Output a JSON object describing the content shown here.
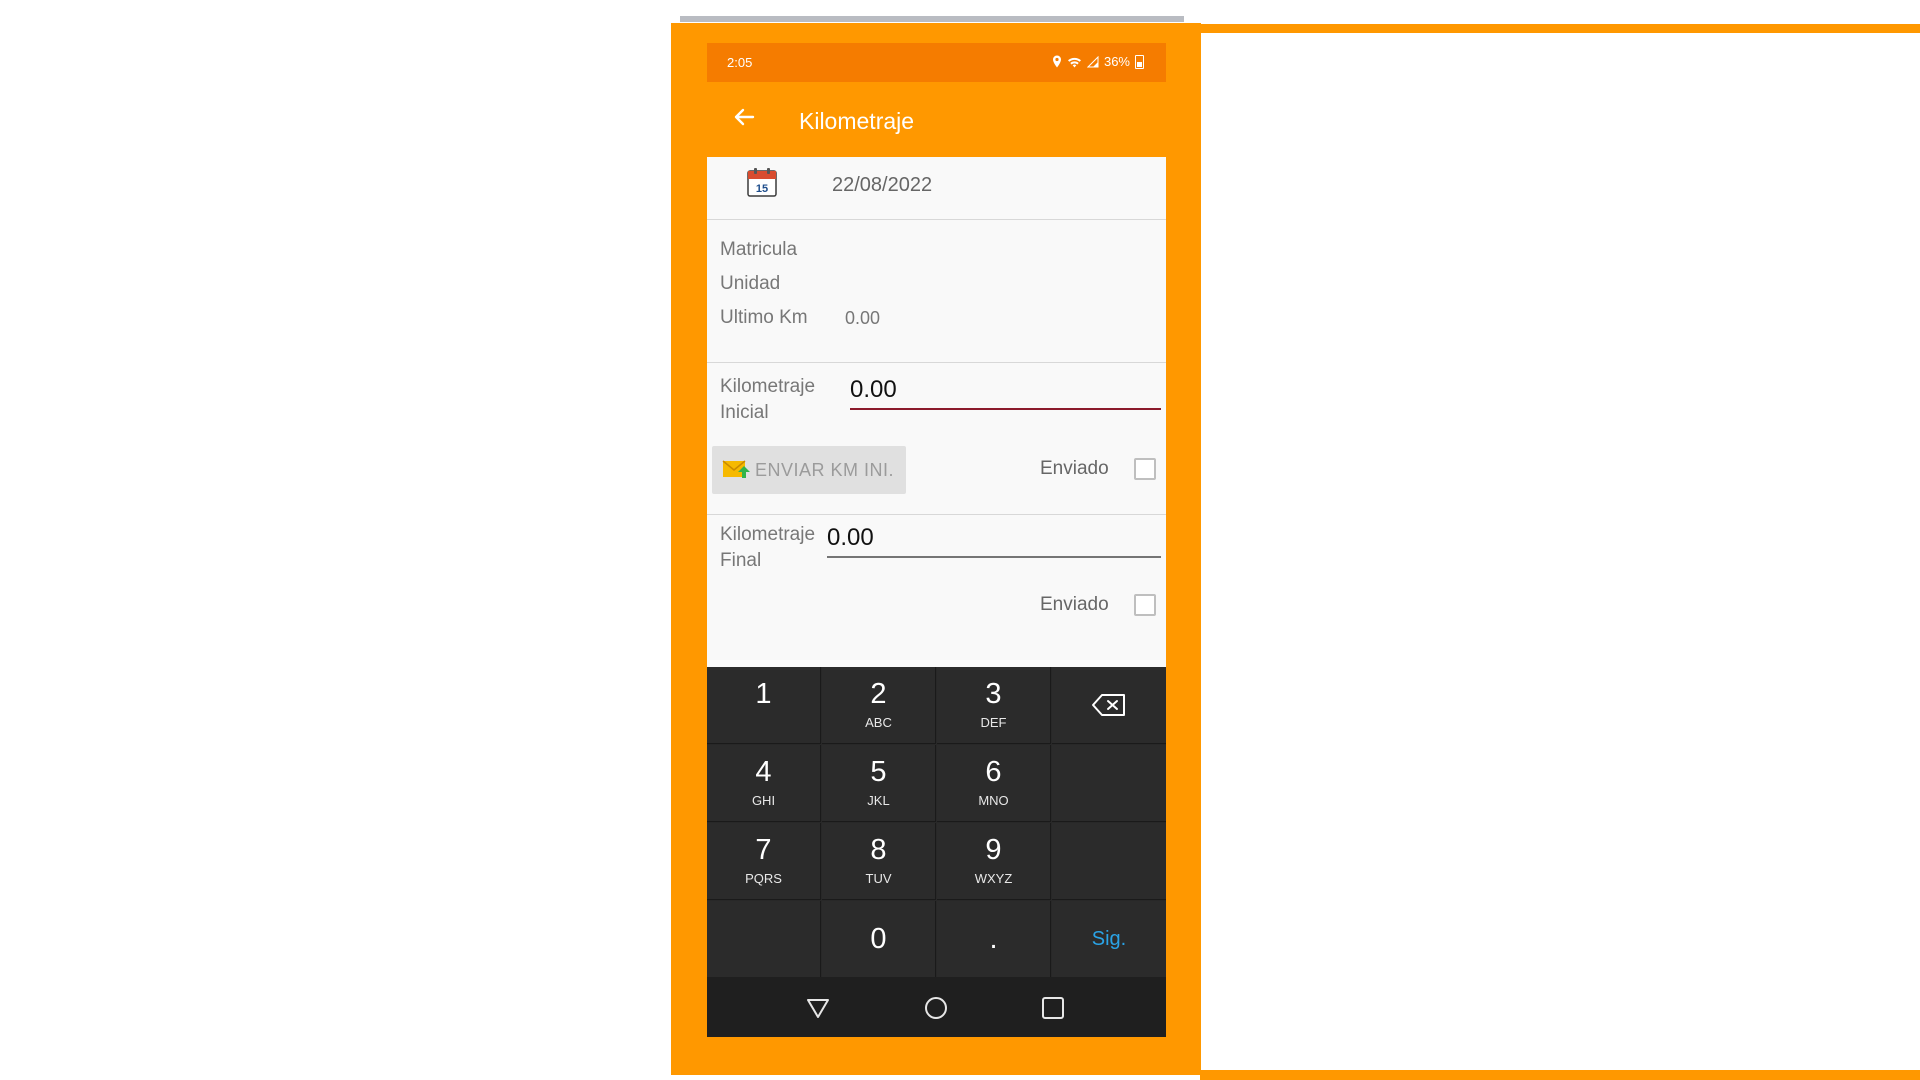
{
  "status_bar": {
    "time": "2:05",
    "battery": "36%"
  },
  "app_bar": {
    "title": "Kilometraje",
    "back_icon": "arrow-left-icon"
  },
  "date_row": {
    "date": "22/08/2022",
    "icon": "calendar-icon",
    "calendar_day": "15"
  },
  "info": {
    "matricula_label": "Matricula",
    "unidad_label": "Unidad",
    "ultimo_km_label": "Ultimo Km",
    "ultimo_km_value": "0.00"
  },
  "km_inicial": {
    "label_line1": "Kilometraje",
    "label_line2": "Inicial",
    "value": "0.00",
    "send_button_label": "ENVIAR KM INI.",
    "enviado_label": "Enviado",
    "enviado_checked": false
  },
  "km_final": {
    "label_line1": "Kilometraje",
    "label_line2": "Final",
    "value": "0.00",
    "enviado_label": "Enviado",
    "enviado_checked": false
  },
  "keypad": {
    "keys": [
      {
        "digit": "1",
        "letters": ""
      },
      {
        "digit": "2",
        "letters": "ABC"
      },
      {
        "digit": "3",
        "letters": "DEF"
      },
      {
        "digit": "4",
        "letters": "GHI"
      },
      {
        "digit": "5",
        "letters": "JKL"
      },
      {
        "digit": "6",
        "letters": "MNO"
      },
      {
        "digit": "7",
        "letters": "PQRS"
      },
      {
        "digit": "8",
        "letters": "TUV"
      },
      {
        "digit": "9",
        "letters": "WXYZ"
      },
      {
        "digit": "0",
        "letters": ""
      },
      {
        "digit": ".",
        "letters": ""
      }
    ],
    "next_label": "Sig."
  },
  "colors": {
    "accent": "#ff9800",
    "status": "#f57c00",
    "input_underline_focused": "#8b1a2b",
    "next_key": "#2aa3e6"
  }
}
